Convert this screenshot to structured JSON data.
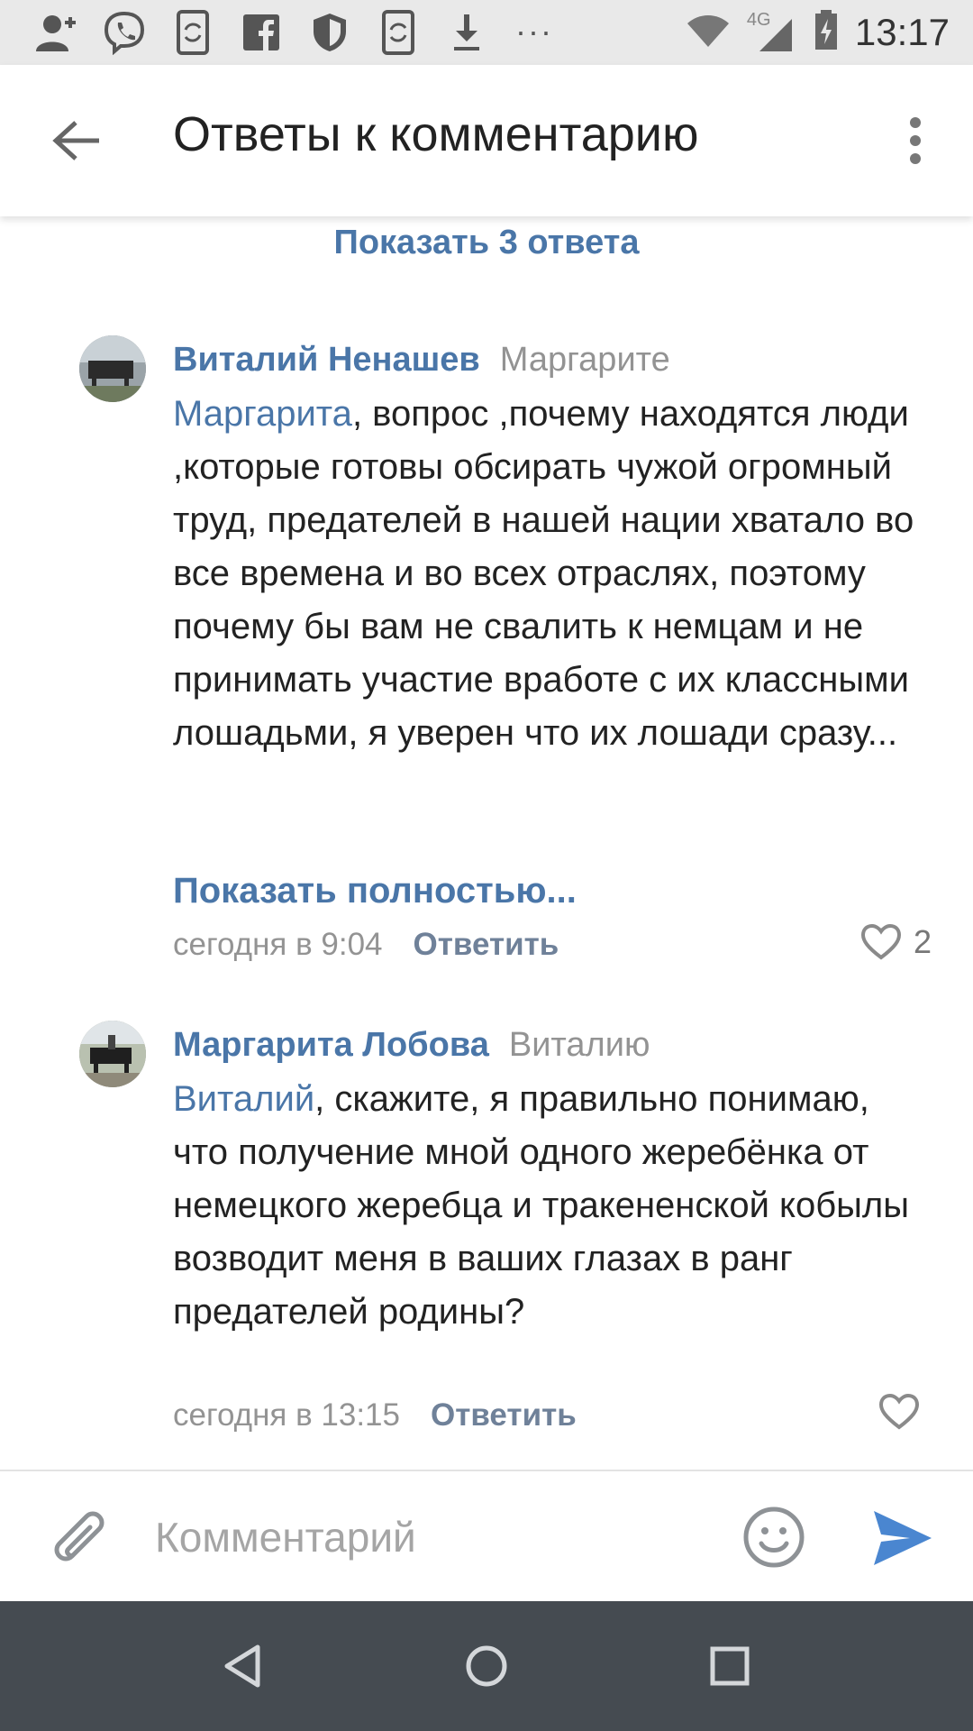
{
  "status_bar": {
    "time": "13:17",
    "network": "4G",
    "overflow": "···",
    "icons": [
      "add-contact-icon",
      "viber-icon",
      "sync-icon",
      "facebook-icon",
      "shield-icon",
      "sync-icon",
      "download-icon"
    ]
  },
  "header": {
    "title": "Ответы к комментарию",
    "back_icon": "arrow-left-icon",
    "more_icon": "more-vertical-icon"
  },
  "show_replies_label": "Показать 3 ответа",
  "comments": [
    {
      "author": "Виталий Ненашев",
      "reply_to": "Маргарите",
      "mention": "Маргарита",
      "text": ", вопрос ,почему находятся люди ,которые готовы обсирать чужой огромный труд, предателей в нашей нации хватало во все времена и во всех отраслях, поэтому почему бы вам не свалить к немцам и не принимать участие вработе с их классными лошадьми, я уверен что их лошади сразу...",
      "show_more": "Показать полностью...",
      "time": "сегодня в 9:04",
      "reply_label": "Ответить",
      "likes": "2"
    },
    {
      "author": "Маргарита Лобова",
      "reply_to": "Виталию",
      "mention": "Виталий",
      "text": ", скажите, я правильно понимаю, что получение мной одного жеребёнка от немецкого жеребца и тракененской кобылы возводит меня в ваших глазах в ранг предателей родины?",
      "time": "сегодня в 13:15",
      "reply_label": "Ответить",
      "likes": ""
    }
  ],
  "composer": {
    "placeholder": "Комментарий",
    "value": ""
  },
  "colors": {
    "accent": "#4a76a8",
    "secondary_text": "#939393",
    "nav_bar": "#454b51",
    "status_bar": "#e9e9e9"
  }
}
